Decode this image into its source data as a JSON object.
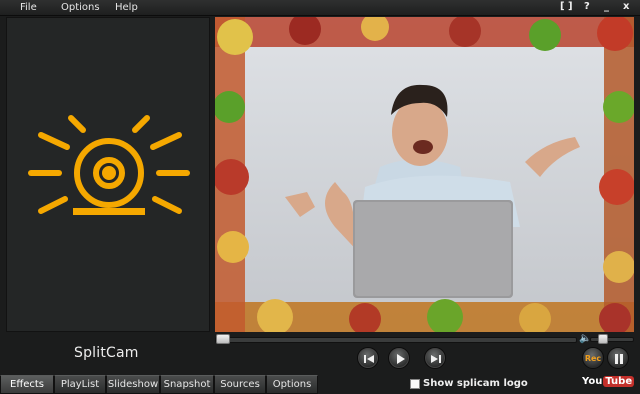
{
  "menu": {
    "file": "File",
    "options": "Options",
    "help": "Help"
  },
  "window_controls": {
    "fullscreen": "[ ]",
    "help": "?",
    "minimize": "_",
    "close": "x"
  },
  "brand": {
    "name": "SplitCam",
    "accent": "#f5a800"
  },
  "transport": {
    "rec_label": "Rec"
  },
  "tabs": [
    {
      "label": "Effects",
      "active": true
    },
    {
      "label": "PlayList",
      "active": false
    },
    {
      "label": "Slideshow",
      "active": false
    },
    {
      "label": "Snapshot",
      "active": false
    },
    {
      "label": "Sources",
      "active": false
    },
    {
      "label": "Options",
      "active": false
    }
  ],
  "show_logo": {
    "label": "Show splicam logo",
    "checked": false
  },
  "youtube": {
    "you": "You",
    "tube": "Tube"
  },
  "playback": {
    "seek_progress": 0.0,
    "volume_level": 0.2
  },
  "icons": [
    "play-icon",
    "previous-icon",
    "next-icon",
    "pause-icon",
    "record-icon",
    "volume-icon",
    "webcam-logo-icon"
  ]
}
